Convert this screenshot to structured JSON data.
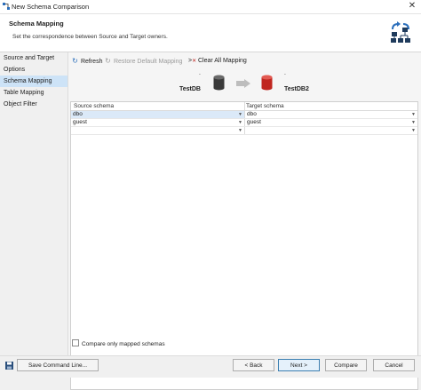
{
  "window": {
    "title": "New Schema Comparison"
  },
  "header": {
    "title": "Schema Mapping",
    "description": "Set the correspondence between Source and Target owners."
  },
  "sidebar": {
    "items": [
      {
        "label": "Source and Target",
        "active": false
      },
      {
        "label": "Options",
        "active": false
      },
      {
        "label": "Schema Mapping",
        "active": true
      },
      {
        "label": "Table Mapping",
        "active": false
      },
      {
        "label": "Object Filter",
        "active": false
      }
    ]
  },
  "toolbar": {
    "refresh": "Refresh",
    "restore": "Restore Default Mapping",
    "clear": "Clear All Mapping"
  },
  "databases": {
    "source": "TestDB",
    "target": "TestDB2",
    "source_marker": "`",
    "target_marker": "`",
    "source_color": "#3a3a3a",
    "target_color": "#c0261f"
  },
  "table": {
    "headers": {
      "source": "Source schema",
      "target": "Target schema"
    },
    "rows": [
      {
        "source": "dbo",
        "target": "dbo"
      },
      {
        "source": "guest",
        "target": "guest"
      },
      {
        "source": "",
        "target": ""
      }
    ]
  },
  "compare_only_label": "Compare only mapped schemas",
  "footer": {
    "save_command": "Save Command Line...",
    "back": "< Back",
    "next": "Next >",
    "compare": "Compare",
    "cancel": "Cancel"
  }
}
